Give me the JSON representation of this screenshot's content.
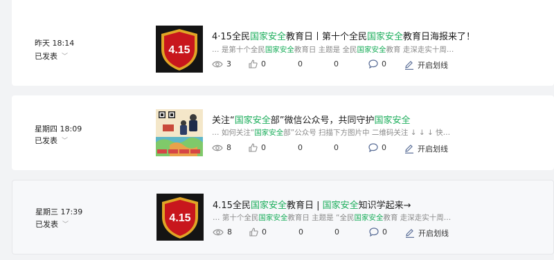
{
  "posts": [
    {
      "time": "昨天 18:14",
      "status": "已发表",
      "thumb_text": "4.15",
      "title_parts": [
        "4·15全民",
        "国家安全",
        "教育日丨第十个全民",
        "国家安全",
        "教育日海报来了！"
      ],
      "summary_parts": [
        "… 是第十个全民",
        "国家安全",
        "教育日 主题是 全民",
        "国家安全",
        "教育 走深走实十周…"
      ],
      "stats": {
        "views": "3",
        "likes": "0",
        "shares": "0",
        "favorites": "0",
        "comments": "0",
        "underline": "开启划线"
      }
    },
    {
      "time": "星期四 18:09",
      "status": "已发表",
      "title_parts": [
        "关注“",
        "国家安全",
        "部”微信公众号，共同守护",
        "国家安全",
        ""
      ],
      "summary_parts": [
        "… 如何关注“",
        "国家安全",
        "部”公众号 扫描下方图片中 二维码关注 ↓ ↓ ↓ 快…",
        "",
        ""
      ],
      "stats": {
        "views": "8",
        "likes": "0",
        "shares": "0",
        "favorites": "0",
        "comments": "0",
        "underline": "开启划线"
      }
    },
    {
      "time": "星期三 17:39",
      "status": "已发表",
      "thumb_text": "4.15",
      "title_parts": [
        "4.15全民",
        "国家安全",
        "教育日 | ",
        "国家安全",
        "知识学起来→"
      ],
      "summary_parts": [
        "… 第十个全民",
        "国家安全",
        "教育日 主题是 “全民",
        "国家安全",
        "教育 走深走实十周…"
      ],
      "stats": {
        "views": "8",
        "likes": "0",
        "shares": "0",
        "favorites": "0",
        "comments": "0",
        "underline": "开启划线"
      }
    }
  ],
  "colors": {
    "highlight": "#1aad5a",
    "link": "#576b95",
    "shield_red": "#c8161d",
    "shield_gold": "#e0a526"
  }
}
